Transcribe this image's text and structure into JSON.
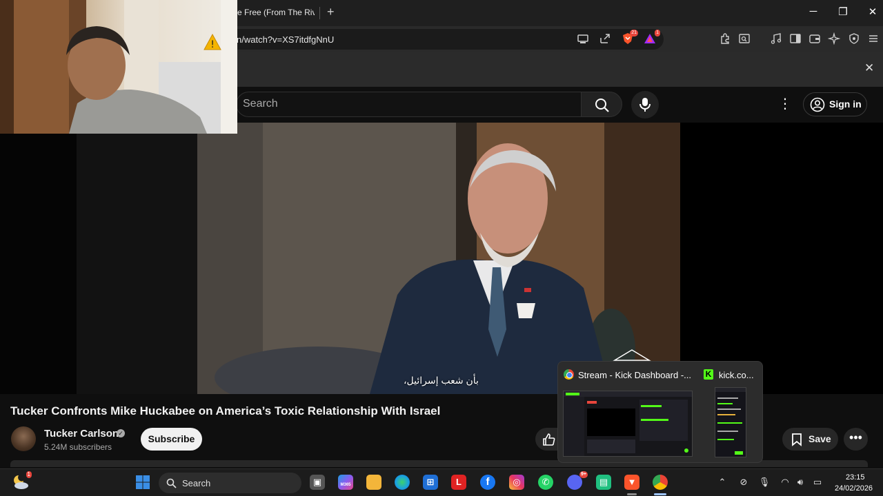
{
  "browser": {
    "tab_title": "e Free (From The River",
    "new_tab": "+",
    "url": "n/watch?v=XS7itdfgNnU",
    "shield_badge": "21",
    "rewards_badge": "1",
    "window": {
      "minimize": "─",
      "maximize": "❐",
      "close": "✕"
    },
    "notice_close": "✕"
  },
  "youtube": {
    "search_placeholder": "Search",
    "sign_in": "Sign in",
    "subtitle": "بأن شعب إسرائيل،",
    "video_title": "Tucker Confronts Mike Huckabee on America’s Toxic Relationship With Israel",
    "channel": "Tucker Carlson",
    "subscribers": "5.24M subscribers",
    "subscribe": "Subscribe",
    "save": "Save",
    "more": "•••"
  },
  "preview": {
    "window1_title": "Stream - Kick Dashboard -...",
    "window2_title": "kick.co...",
    "window2_icon": "K"
  },
  "taskbar": {
    "search_label": "Search",
    "weather_badge": "1",
    "time": "23:15",
    "date": "24/02/2026",
    "discord_badge": "9+",
    "app_letters": {
      "l_app": "L",
      "facebook": "f",
      "m365": "M365"
    }
  },
  "colors": {
    "yt_background": "#0f0f0f",
    "kick_green": "#53fc18",
    "brave_orange": "#fb542b",
    "win_blue": "#3a8ee6"
  }
}
